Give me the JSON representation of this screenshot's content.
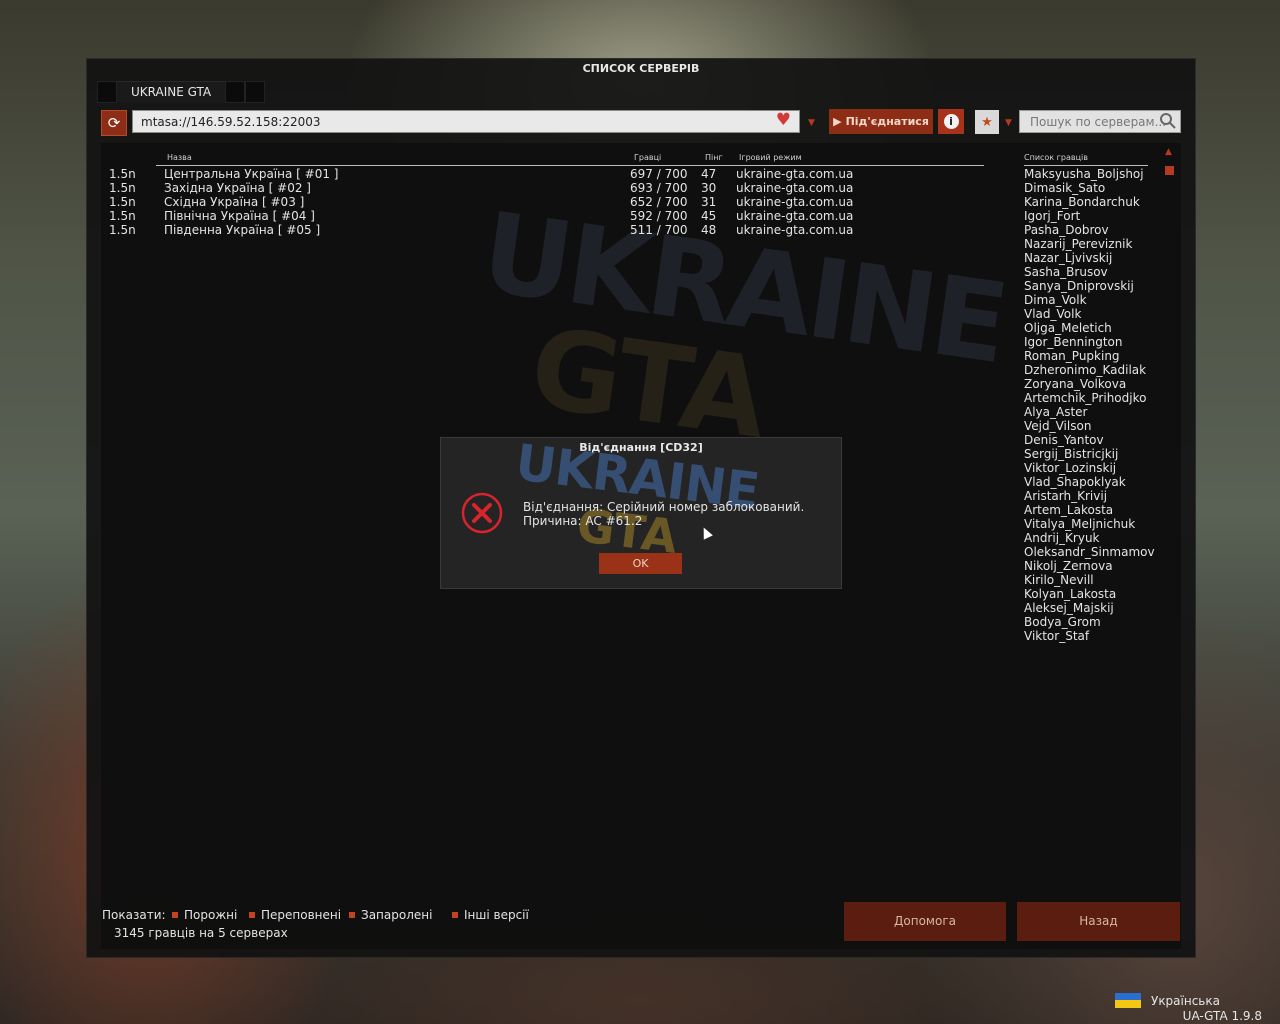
{
  "window": {
    "title": "СПИСОК СЕРВЕРІВ"
  },
  "tabs": [
    {
      "label": "UKRAINE GTA"
    }
  ],
  "toolbar": {
    "address": "mtasa://146.59.52.158:22003",
    "connect_label": "Під'єднатися",
    "search_placeholder": "Пошук по серверам..."
  },
  "columns": {
    "name": "Назва",
    "players": "Гравці",
    "ping": "Пінг",
    "gamemode": "Ігровий режим",
    "player_list": "Список гравців"
  },
  "servers": [
    {
      "version": "1.5n",
      "name": "Центральна Україна [ #01 ]",
      "players": "697 / 700",
      "ping": "47",
      "gamemode": "ukraine-gta.com.ua"
    },
    {
      "version": "1.5n",
      "name": "Західна Україна [ #02 ]",
      "players": "693 / 700",
      "ping": "30",
      "gamemode": "ukraine-gta.com.ua"
    },
    {
      "version": "1.5n",
      "name": "Східна Україна [ #03 ]",
      "players": "652 / 700",
      "ping": "31",
      "gamemode": "ukraine-gta.com.ua"
    },
    {
      "version": "1.5n",
      "name": "Північна Україна [ #04 ]",
      "players": "592 / 700",
      "ping": "45",
      "gamemode": "ukraine-gta.com.ua"
    },
    {
      "version": "1.5n",
      "name": "Південна Україна [ #05 ]",
      "players": "511 / 700",
      "ping": "48",
      "gamemode": "ukraine-gta.com.ua"
    }
  ],
  "players": [
    "Maksyusha_Boljshoj",
    "Dimasik_Sato",
    "Karina_Bondarchuk",
    "Igorj_Fort",
    "Pasha_Dobrov",
    "Nazarij_Pereviznik",
    "Nazar_Ljvivskij",
    "Sasha_Brusov",
    "Sanya_Dniprovskij",
    "Dima_Volk",
    "Vlad_Volk",
    "Oljga_Meletich",
    "Igor_Bennington",
    "Roman_Pupking",
    "Dzheronimo_Kadilak",
    "Zoryana_Volkova",
    "Artemchik_Prihodjko",
    "Alya_Aster",
    "Vejd_Vilson",
    "Denis_Yantov",
    "Sergij_Bistricjkij",
    "Viktor_Lozinskij",
    "Vlad_Shapoklyak",
    "Aristarh_Krivij",
    "Artem_Lakosta",
    "Vitalya_Meljnichuk",
    "Andrij_Kryuk",
    "Oleksandr_Sinmamov",
    "Nikolj_Zernova",
    "Kirilo_Nevill",
    "Kolyan_Lakosta",
    "Aleksej_Majskij",
    "Bodya_Grom",
    "Viktor_Staf"
  ],
  "dialog": {
    "title": "Від'єднання [CD32]",
    "line1": "Від'єднання: Серійний номер заблокований.",
    "line2": "Причина: AC #61.2",
    "ok_label": "OK",
    "logo_top": "UKRAINE",
    "logo_bottom": "GTA"
  },
  "filters": {
    "label": "Показати:",
    "items": [
      "Порожні",
      "Переповнені",
      "Запаролені",
      "Інші версії"
    ]
  },
  "summary": "3145 гравців на 5 серверах",
  "buttons": {
    "help": "Допомога",
    "back": "Назад"
  },
  "footer": {
    "language": "Українська",
    "version": "UA-GTA 1.9.8"
  },
  "background": {
    "logo_top": "UKRAINE",
    "logo_bottom": "GTA"
  },
  "colors": {
    "accent": "#8e2d16",
    "button_dark": "#5a1d0f",
    "error": "#d9232e"
  }
}
